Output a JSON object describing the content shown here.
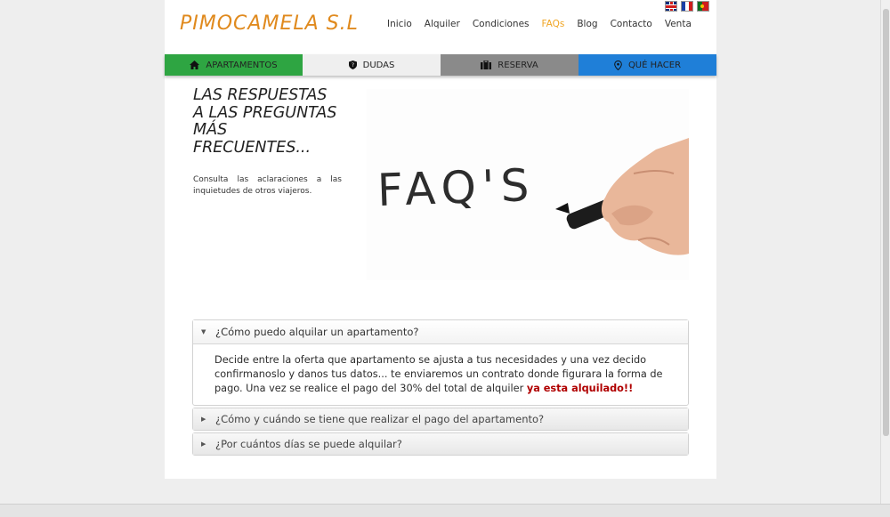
{
  "header": {
    "logo_text": "PIMOCAMELA S.L",
    "nav": [
      "Inicio",
      "Alquiler",
      "Condiciones",
      "FAQs",
      "Blog",
      "Contacto",
      "Venta"
    ],
    "active_nav": "FAQs",
    "flags": [
      "flag-english-icon",
      "flag-french-icon",
      "flag-portuguese-icon"
    ]
  },
  "tabs": [
    {
      "label": "APARTAMENTOS",
      "icon": "home-icon",
      "color": "#2ea542"
    },
    {
      "label": "DUDAS",
      "icon": "shield-icon",
      "color": "#efefef"
    },
    {
      "label": "RESERVA",
      "icon": "briefcase-icon",
      "color": "#8a8a8a"
    },
    {
      "label": "QUÉ HACER",
      "icon": "map-pin-icon",
      "color": "#1f7fd8"
    }
  ],
  "hero": {
    "title": "LAS RESPUESTAS\nA LAS PREGUNTAS\nMÁS\nFRECUENTES...",
    "subtitle": "Consulta las aclaraciones a las inquietudes de otros viajeros.",
    "image_text": "FAQ'S"
  },
  "faq": {
    "items": [
      {
        "question": "¿Cómo puedo alquilar un apartamento?",
        "expanded": true,
        "answer": "Decide entre la oferta que apartamento se ajusta a tus necesidades y una vez decido confirmanoslo y danos tus datos... te enviaremos un contrato donde figurara la forma de pago. Una vez se realice el pago del 30% del total de alquiler",
        "answer_highlight": "ya esta alquilado!!"
      },
      {
        "question": "¿Cómo y cuándo se tiene que realizar el pago del apartamento?",
        "expanded": false
      },
      {
        "question": "¿Por cuántos días se puede alquilar?",
        "expanded": false
      }
    ]
  },
  "colors": {
    "accent": "#f0a523",
    "highlight": "#b00000"
  }
}
